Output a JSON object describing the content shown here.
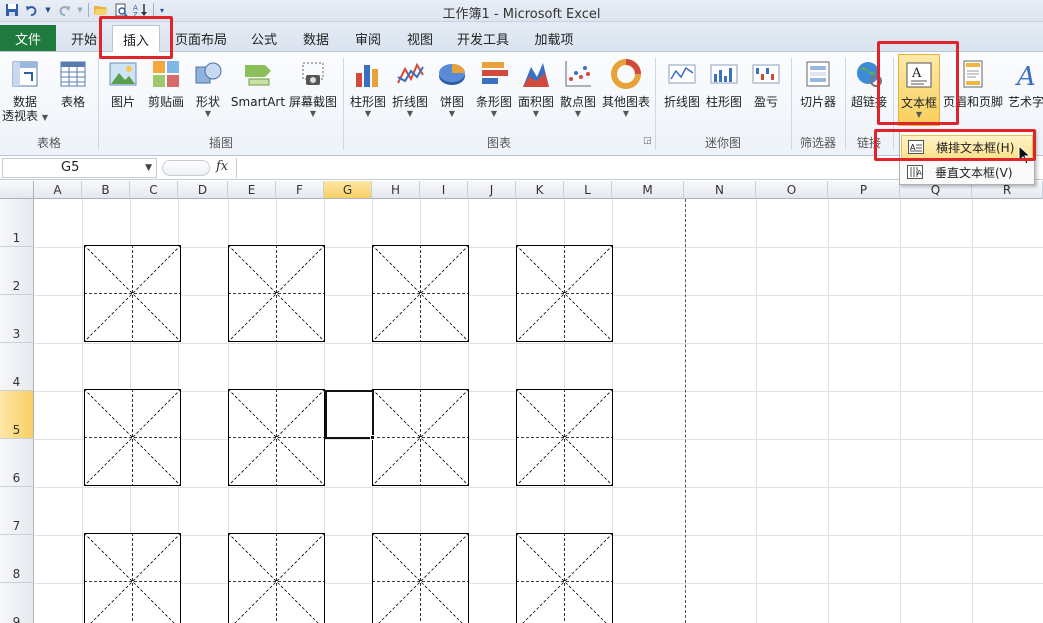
{
  "window": {
    "title": "工作簿1  -  Microsoft Excel"
  },
  "qat": {
    "icons": [
      "save-icon",
      "undo-icon",
      "redo-icon",
      "open-icon",
      "print-preview-icon",
      "sort-icon",
      "customize-icon"
    ]
  },
  "tabs": {
    "file": "文件",
    "items": [
      "开始",
      "插入",
      "页面布局",
      "公式",
      "数据",
      "审阅",
      "视图",
      "开发工具",
      "加载项"
    ],
    "active": "插入"
  },
  "ribbon": {
    "pivot": {
      "line1": "数据",
      "line2": "透视表"
    },
    "table": "表格",
    "picture": "图片",
    "clipart": "剪贴画",
    "shapes": "形状",
    "smartart": "SmartArt",
    "screenshot": "屏幕截图",
    "column": "柱形图",
    "line": "折线图",
    "pie": "饼图",
    "bar": "条形图",
    "area": "面积图",
    "scatter": "散点图",
    "other": "其他图表",
    "spark_line": "折线图",
    "spark_column": "柱形图",
    "spark_winloss": "盈亏",
    "slicer": "切片器",
    "hyperlink": "超链接",
    "textbox": "文本框",
    "header_footer": "页眉和页脚",
    "wordart": "艺术字",
    "groups": {
      "tables": "表格",
      "illustrations": "插图",
      "charts": "图表",
      "sparklines": "迷你图",
      "filter": "筛选器",
      "links": "链接"
    }
  },
  "formula_bar": {
    "name_box": "G5",
    "fx": "fx",
    "value": ""
  },
  "columns": [
    "A",
    "B",
    "C",
    "D",
    "E",
    "F",
    "G",
    "H",
    "I",
    "J",
    "K",
    "L",
    "M",
    "N",
    "O",
    "P",
    "Q",
    "R"
  ],
  "rows": [
    "1",
    "2",
    "3",
    "4",
    "5",
    "6",
    "7",
    "8",
    "9"
  ],
  "selected_cell": {
    "column": "G",
    "row": "5"
  },
  "dropdown": {
    "horizontal": "横排文本框(H)",
    "vertical": "垂直文本框(V)"
  },
  "colors": {
    "file_tab": "#1f7a3d",
    "highlight": "#f9cf5c",
    "callout": "#e0242c"
  }
}
